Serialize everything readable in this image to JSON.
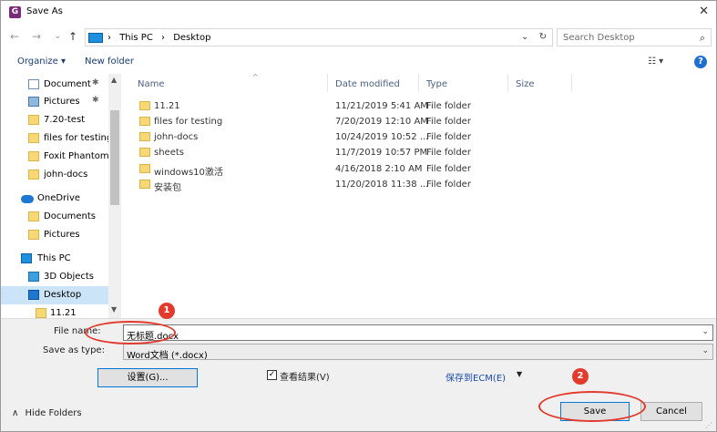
{
  "window": {
    "title": "Save As",
    "close_glyph": "✕"
  },
  "nav": {
    "back": "←",
    "forward": "→",
    "dropdown": "⌄",
    "up": "↑"
  },
  "address": {
    "crumbs": [
      "This PC",
      "Desktop"
    ],
    "separator": "›",
    "dropdown": "⌄",
    "refresh": "↻"
  },
  "search": {
    "placeholder": "Search Desktop",
    "icon": "⌕"
  },
  "toolbar": {
    "organize": "Organize ▾",
    "new_folder": "New folder",
    "view": "☷ ▾",
    "help": "?"
  },
  "sidebar": {
    "items": [
      {
        "label": "Documents",
        "icon": "document-icon",
        "pinned": true
      },
      {
        "label": "Pictures",
        "icon": "picture-icon",
        "pinned": true
      },
      {
        "label": "7.20-test",
        "icon": "folder-icon"
      },
      {
        "label": "files for testing",
        "icon": "folder-icon"
      },
      {
        "label": "Foxit PhantomPDF",
        "icon": "folder-icon"
      },
      {
        "label": "john-docs",
        "icon": "folder-icon"
      },
      {
        "label": "OneDrive",
        "icon": "cloud-icon"
      },
      {
        "label": "Documents",
        "icon": "folder-icon"
      },
      {
        "label": "Pictures",
        "icon": "folder-icon"
      },
      {
        "label": "This PC",
        "icon": "computer-icon"
      },
      {
        "label": "3D Objects",
        "icon": "cube-icon"
      },
      {
        "label": "Desktop",
        "icon": "desktop-icon",
        "selected": true
      },
      {
        "label": "11.21",
        "icon": "folder-icon"
      }
    ],
    "pin_glyph": "✱"
  },
  "table": {
    "columns": [
      "Name",
      "Date modified",
      "Type",
      "Size"
    ],
    "sort_glyph": "^",
    "rows": [
      {
        "name": "11.21",
        "date": "11/21/2019 5:41 AM",
        "type": "File folder"
      },
      {
        "name": "files for testing",
        "date": "7/20/2019 12:10 AM",
        "type": "File folder"
      },
      {
        "name": "john-docs",
        "date": "10/24/2019 10:52 ...",
        "type": "File folder"
      },
      {
        "name": "sheets",
        "date": "11/7/2019 10:57 PM",
        "type": "File folder"
      },
      {
        "name": "windows10激活",
        "date": "4/16/2018 2:10 AM",
        "type": "File folder"
      },
      {
        "name": "安装包",
        "date": "11/20/2018 11:38 ...",
        "type": "File folder"
      }
    ]
  },
  "form": {
    "filename_label": "File name:",
    "filename_value": "无标题.docx",
    "savetype_label": "Save as type:",
    "savetype_value": "Word文档 (*.docx)",
    "dropdown_glyph": "⌄",
    "settings_button": "设置(G)...",
    "view_result_label": "查看结果(V)",
    "view_result_checked": "✓",
    "save_to_ecm": "保存到ECM(E)",
    "ecm_arrow": "▼",
    "hide_folders": "Hide Folders",
    "hide_folders_glyph": "∧",
    "save_button": "Save",
    "cancel_button": "Cancel"
  },
  "annotations": [
    {
      "number": "1"
    },
    {
      "number": "2"
    }
  ],
  "colors": {
    "accent": "#0078d7",
    "annotation": "#e23b2e",
    "selected_bg": "#cce4f7",
    "folder": "#f8d775"
  }
}
